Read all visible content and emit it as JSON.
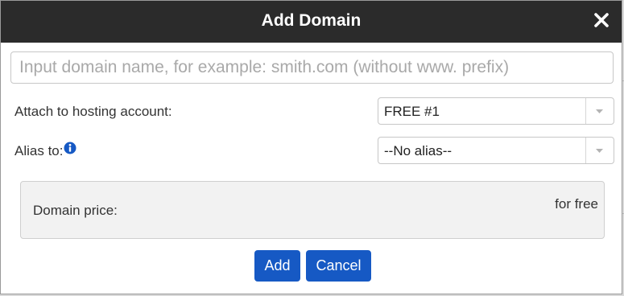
{
  "dialog": {
    "title": "Add Domain",
    "close_label": "close"
  },
  "domain_input": {
    "value": "",
    "placeholder": "Input domain name, for example: smith.com (without www. prefix)"
  },
  "hosting": {
    "label": "Attach to hosting account:",
    "selected": "FREE #1"
  },
  "alias": {
    "label": "Alias to:",
    "selected": "--No alias--"
  },
  "price": {
    "label": "Domain price:",
    "value": "for free"
  },
  "buttons": {
    "add": "Add",
    "cancel": "Cancel"
  },
  "colors": {
    "titlebar": "#2b2b2b",
    "button": "#1659c4",
    "info_icon": "#1659c4"
  },
  "icons": {
    "close": "close-icon",
    "info": "info-icon",
    "dropdown": "chevron-down-icon"
  }
}
